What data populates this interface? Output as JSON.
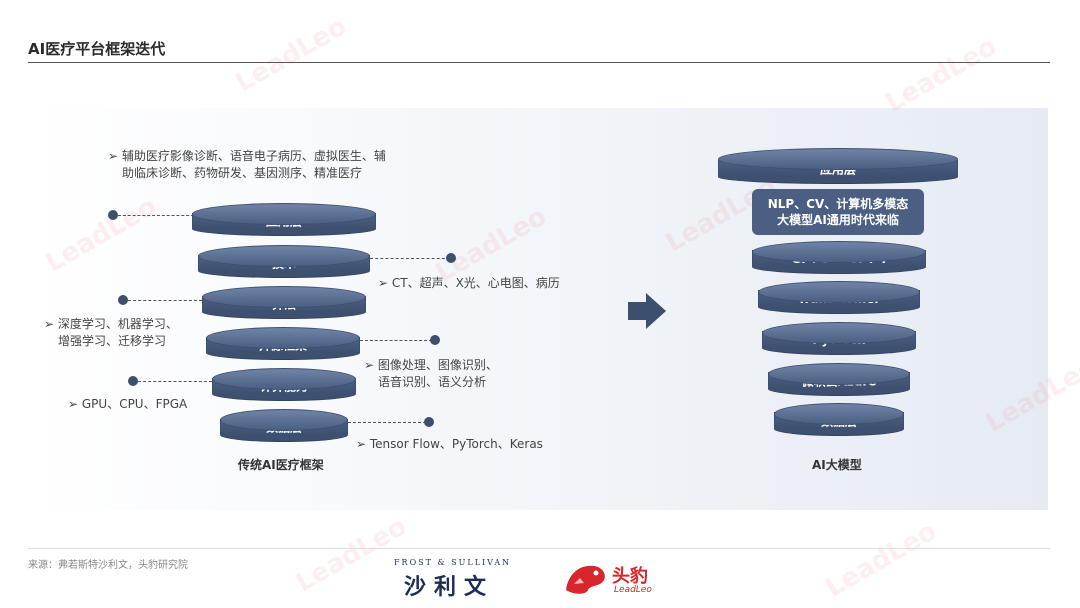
{
  "title": "AI医疗平台框架迭代",
  "left": {
    "caption": "传统AI医疗框架",
    "layers": [
      "应用层",
      "技术",
      "算法",
      "开源框架",
      "计算能力",
      "数据层"
    ],
    "notes": {
      "app_line1": "➢ 辅助医疗影像诊断、语音电子病历、虚拟医生、辅",
      "app_line2": "助临床诊断、药物研发、基因测序、精准医疗",
      "tech": "➢ CT、超声、X光、心电图、病历",
      "algo_line1": "➢ 深度学习、机器学习、",
      "algo_line2": "增强学习、迁移学习",
      "framework_line1": "➢ 图像处理、图像识别、",
      "framework_line2": "语音识别、语义分析",
      "compute": "➢ GPU、CPU、FPGA",
      "data": "➢ Tensor Flow、PyTorch、Keras"
    }
  },
  "right": {
    "caption": "AI大模型",
    "callout_line1": "NLP、CV、计算机多模态",
    "callout_line2": "大模型AI通用时代来临",
    "layers": [
      "应用层",
      "GPT-3 → GPT-4",
      "Transformer",
      "PyTorch",
      "微软云Azure",
      "数据层"
    ]
  },
  "footer": {
    "source": "来源：弗若斯特沙利文，头豹研究院",
    "frost_sullivan": "FROST & SULLIVAN",
    "frost_cn": "沙利文",
    "leadleo_cn": "头豹",
    "leadleo_en": "LeadLeo"
  },
  "colors": {
    "cylinder": "#4a5f82",
    "accent": "#d9262c",
    "navy": "#1e2d57"
  }
}
